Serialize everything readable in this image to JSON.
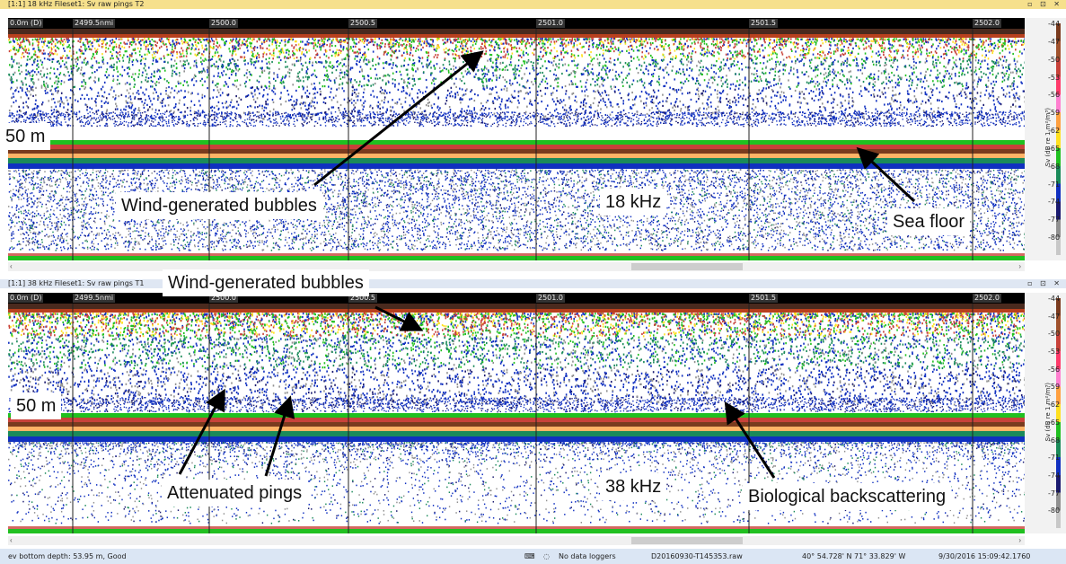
{
  "panels": [
    {
      "title": "[1:1] 18 kHz Fileset1: Sv raw pings T2",
      "window_controls": "▫ ⊡ ✕",
      "ruler_ticks": [
        "0.0m (D)",
        "2499.5nmi",
        "2500.0",
        "2500.5",
        "2501.0",
        "2501.5",
        "2502.0"
      ],
      "frequency": "18 kHz",
      "depth_label": "50 m"
    },
    {
      "title": "[1:1] 38 kHz Fileset1: Sv raw pings T1",
      "window_controls": "▫ ⊡ ✕",
      "ruler_ticks": [
        "0.0m (D)",
        "2499.5nmi",
        "2500.0",
        "2500.5",
        "2501.0",
        "2501.5",
        "2502.0"
      ],
      "frequency": "38 kHz",
      "depth_label": "50 m"
    }
  ],
  "colorbar": {
    "title": "Sv (dB re 1 m²/m³)",
    "labels": [
      "-44",
      "-47",
      "-50",
      "-53",
      "-56",
      "-59",
      "-62",
      "-65",
      "-68",
      "-71",
      "-74",
      "-77",
      "-80"
    ],
    "colors": [
      "#7a3b1e",
      "#a0522d",
      "#c8423a",
      "#ff3b6b",
      "#ff7fd0",
      "#ffa040",
      "#ffe020",
      "#20c020",
      "#1a8a5a",
      "#1030c0",
      "#1a1a70",
      "#909090",
      "#c8c8c8"
    ]
  },
  "annotations": {
    "top_bubbles": "Wind-generated bubbles",
    "top_sea_floor": "Sea floor",
    "bottom_bubbles": "Wind-generated bubbles",
    "attenuated": "Attenuated pings",
    "biological": "Biological backscattering"
  },
  "scrollbar": {
    "left_arrow": "‹",
    "right_arrow": "›"
  },
  "statusbar": {
    "bottom_depth": "ev bottom depth: 53.95  m, Good",
    "loggers": "No data loggers",
    "file": "D20160930-T145353.raw",
    "position": "40° 54.728' N 71° 33.829' W",
    "timestamp": "9/30/2016 15:09:42.1760"
  }
}
